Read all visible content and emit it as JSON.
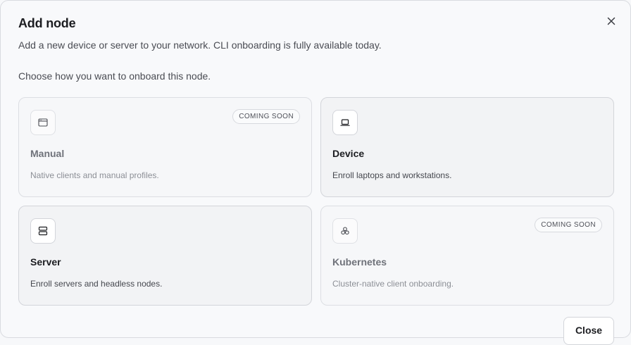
{
  "dialog": {
    "title": "Add node",
    "subtitle": "Add a new device or server to your network. CLI onboarding is fully available today.",
    "prompt": "Choose how you want to onboard this node.",
    "close_button": "Close",
    "close_icon": "close-icon"
  },
  "options": [
    {
      "name": "Manual",
      "description": "Native clients and manual profiles.",
      "badge": "COMING SOON",
      "icon": "browser-window-icon",
      "enabled": false
    },
    {
      "name": "Device",
      "description": "Enroll laptops and workstations.",
      "badge": "",
      "icon": "laptop-icon",
      "enabled": true
    },
    {
      "name": "Server",
      "description": "Enroll servers and headless nodes.",
      "badge": "",
      "icon": "server-icon",
      "enabled": true
    },
    {
      "name": "Kubernetes",
      "description": "Cluster-native client onboarding.",
      "badge": "COMING SOON",
      "icon": "cluster-icon",
      "enabled": false
    }
  ],
  "colors": {
    "text_primary": "#1c1d21",
    "text_muted": "#8c8f96",
    "border": "#dcdee3",
    "background": "#f8f9fb"
  }
}
